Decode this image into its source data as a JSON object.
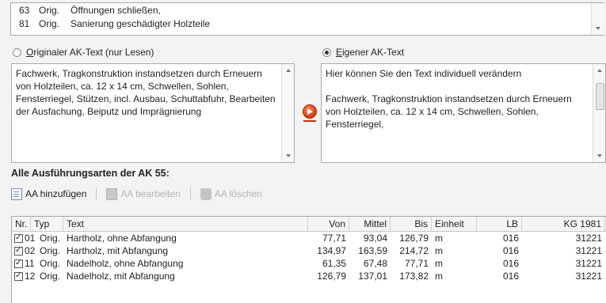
{
  "top_list": {
    "rows": [
      {
        "nr": "63",
        "typ": "Orig.",
        "text": "Öffnungen schließen,"
      },
      {
        "nr": "81",
        "typ": "Orig.",
        "text": "Sanierung geschädigter Holzteile"
      }
    ]
  },
  "options": {
    "original_label_u": "O",
    "original_label_rest": "riginaler AK-Text (nur Lesen)",
    "own_label_u": "E",
    "own_label_rest": "igener AK-Text",
    "selected": "own"
  },
  "original_text": "Fachwerk, Tragkonstruktion instandsetzen durch Erneuern von Holzteilen, ca. 12 x 14 cm, Schwellen, Sohlen,  Fensterriegel, Stützen, incl. Ausbau, Schuttabfuhr, Bearbeiten der Ausfachung, Beiputz und Imprägnierung",
  "own_text": "Hier können Sie den Text individuell verändern\n\nFachwerk, Tragkonstruktion instandsetzen durch Erneuern von Holzteilen, ca. 12 x 14 cm, Schwellen, Sohlen,  Fensterriegel,",
  "section_title": "Alle Ausführungsarten der AK 55:",
  "toolbar": {
    "add_label": "AA hinzufügen",
    "edit_label": "AA bearbeiten",
    "delete_label": "AA löschen"
  },
  "table": {
    "headers": [
      "Nr.",
      "Typ",
      "Text",
      "Von",
      "Mittel",
      "Bis",
      "Einheit",
      "LB",
      "KG 1981"
    ],
    "rows": [
      {
        "checked": true,
        "nr": "01",
        "typ": "Orig.",
        "text": "Hartholz, ohne Abfangung",
        "von": "77,71",
        "mittel": "93,04",
        "bis": "126,79",
        "einheit": "m",
        "lb": "016",
        "kg": "31221"
      },
      {
        "checked": true,
        "nr": "02",
        "typ": "Orig.",
        "text": "Hartholz, mit Abfangung",
        "von": "134,97",
        "mittel": "163,59",
        "bis": "214,72",
        "einheit": "m",
        "lb": "016",
        "kg": "31221"
      },
      {
        "checked": true,
        "nr": "11",
        "typ": "Orig.",
        "text": "Nadelholz, ohne Abfangung",
        "von": "61,35",
        "mittel": "67,48",
        "bis": "77,71",
        "einheit": "m",
        "lb": "016",
        "kg": "31221"
      },
      {
        "checked": true,
        "nr": "12",
        "typ": "Orig.",
        "text": "Nadelholz, mit Abfangung",
        "von": "126,79",
        "mittel": "137,01",
        "bis": "173,82",
        "einheit": "m",
        "lb": "016",
        "kg": "31221"
      }
    ]
  }
}
